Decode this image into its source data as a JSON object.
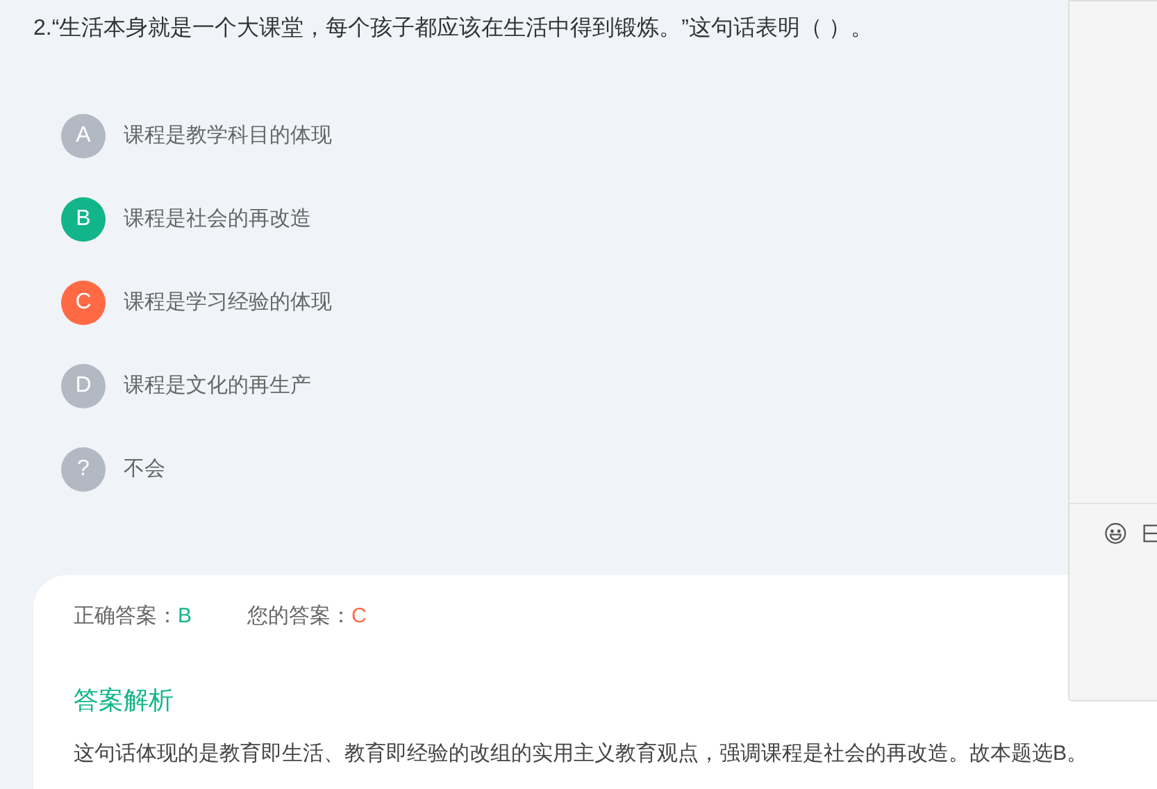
{
  "question": {
    "number": "2.",
    "text": "“生活本身就是一个大课堂，每个孩子都应该在生活中得到锻炼。”这句话表明（ ）。"
  },
  "options": [
    {
      "letter": "A",
      "text": "课程是教学科目的体现",
      "color": "#b3b9c3"
    },
    {
      "letter": "B",
      "text": "课程是社会的再改造",
      "color": "#11b589"
    },
    {
      "letter": "C",
      "text": "课程是学习经验的体现",
      "color": "#ff6a45"
    },
    {
      "letter": "D",
      "text": "课程是文化的再生产",
      "color": "#b3b9c3"
    },
    {
      "letter": "?",
      "text": "不会",
      "color": "#b3b9c3"
    }
  ],
  "result": {
    "correct_label": "正确答案：",
    "correct_value": "B",
    "yours_label": "您的答案：",
    "yours_value": "C"
  },
  "analysis": {
    "title": "答案解析",
    "text": "这句话体现的是教育即生活、教育即经验的改组的实用主义教育观点，强调课程是社会的再改造。故本题选B。"
  }
}
